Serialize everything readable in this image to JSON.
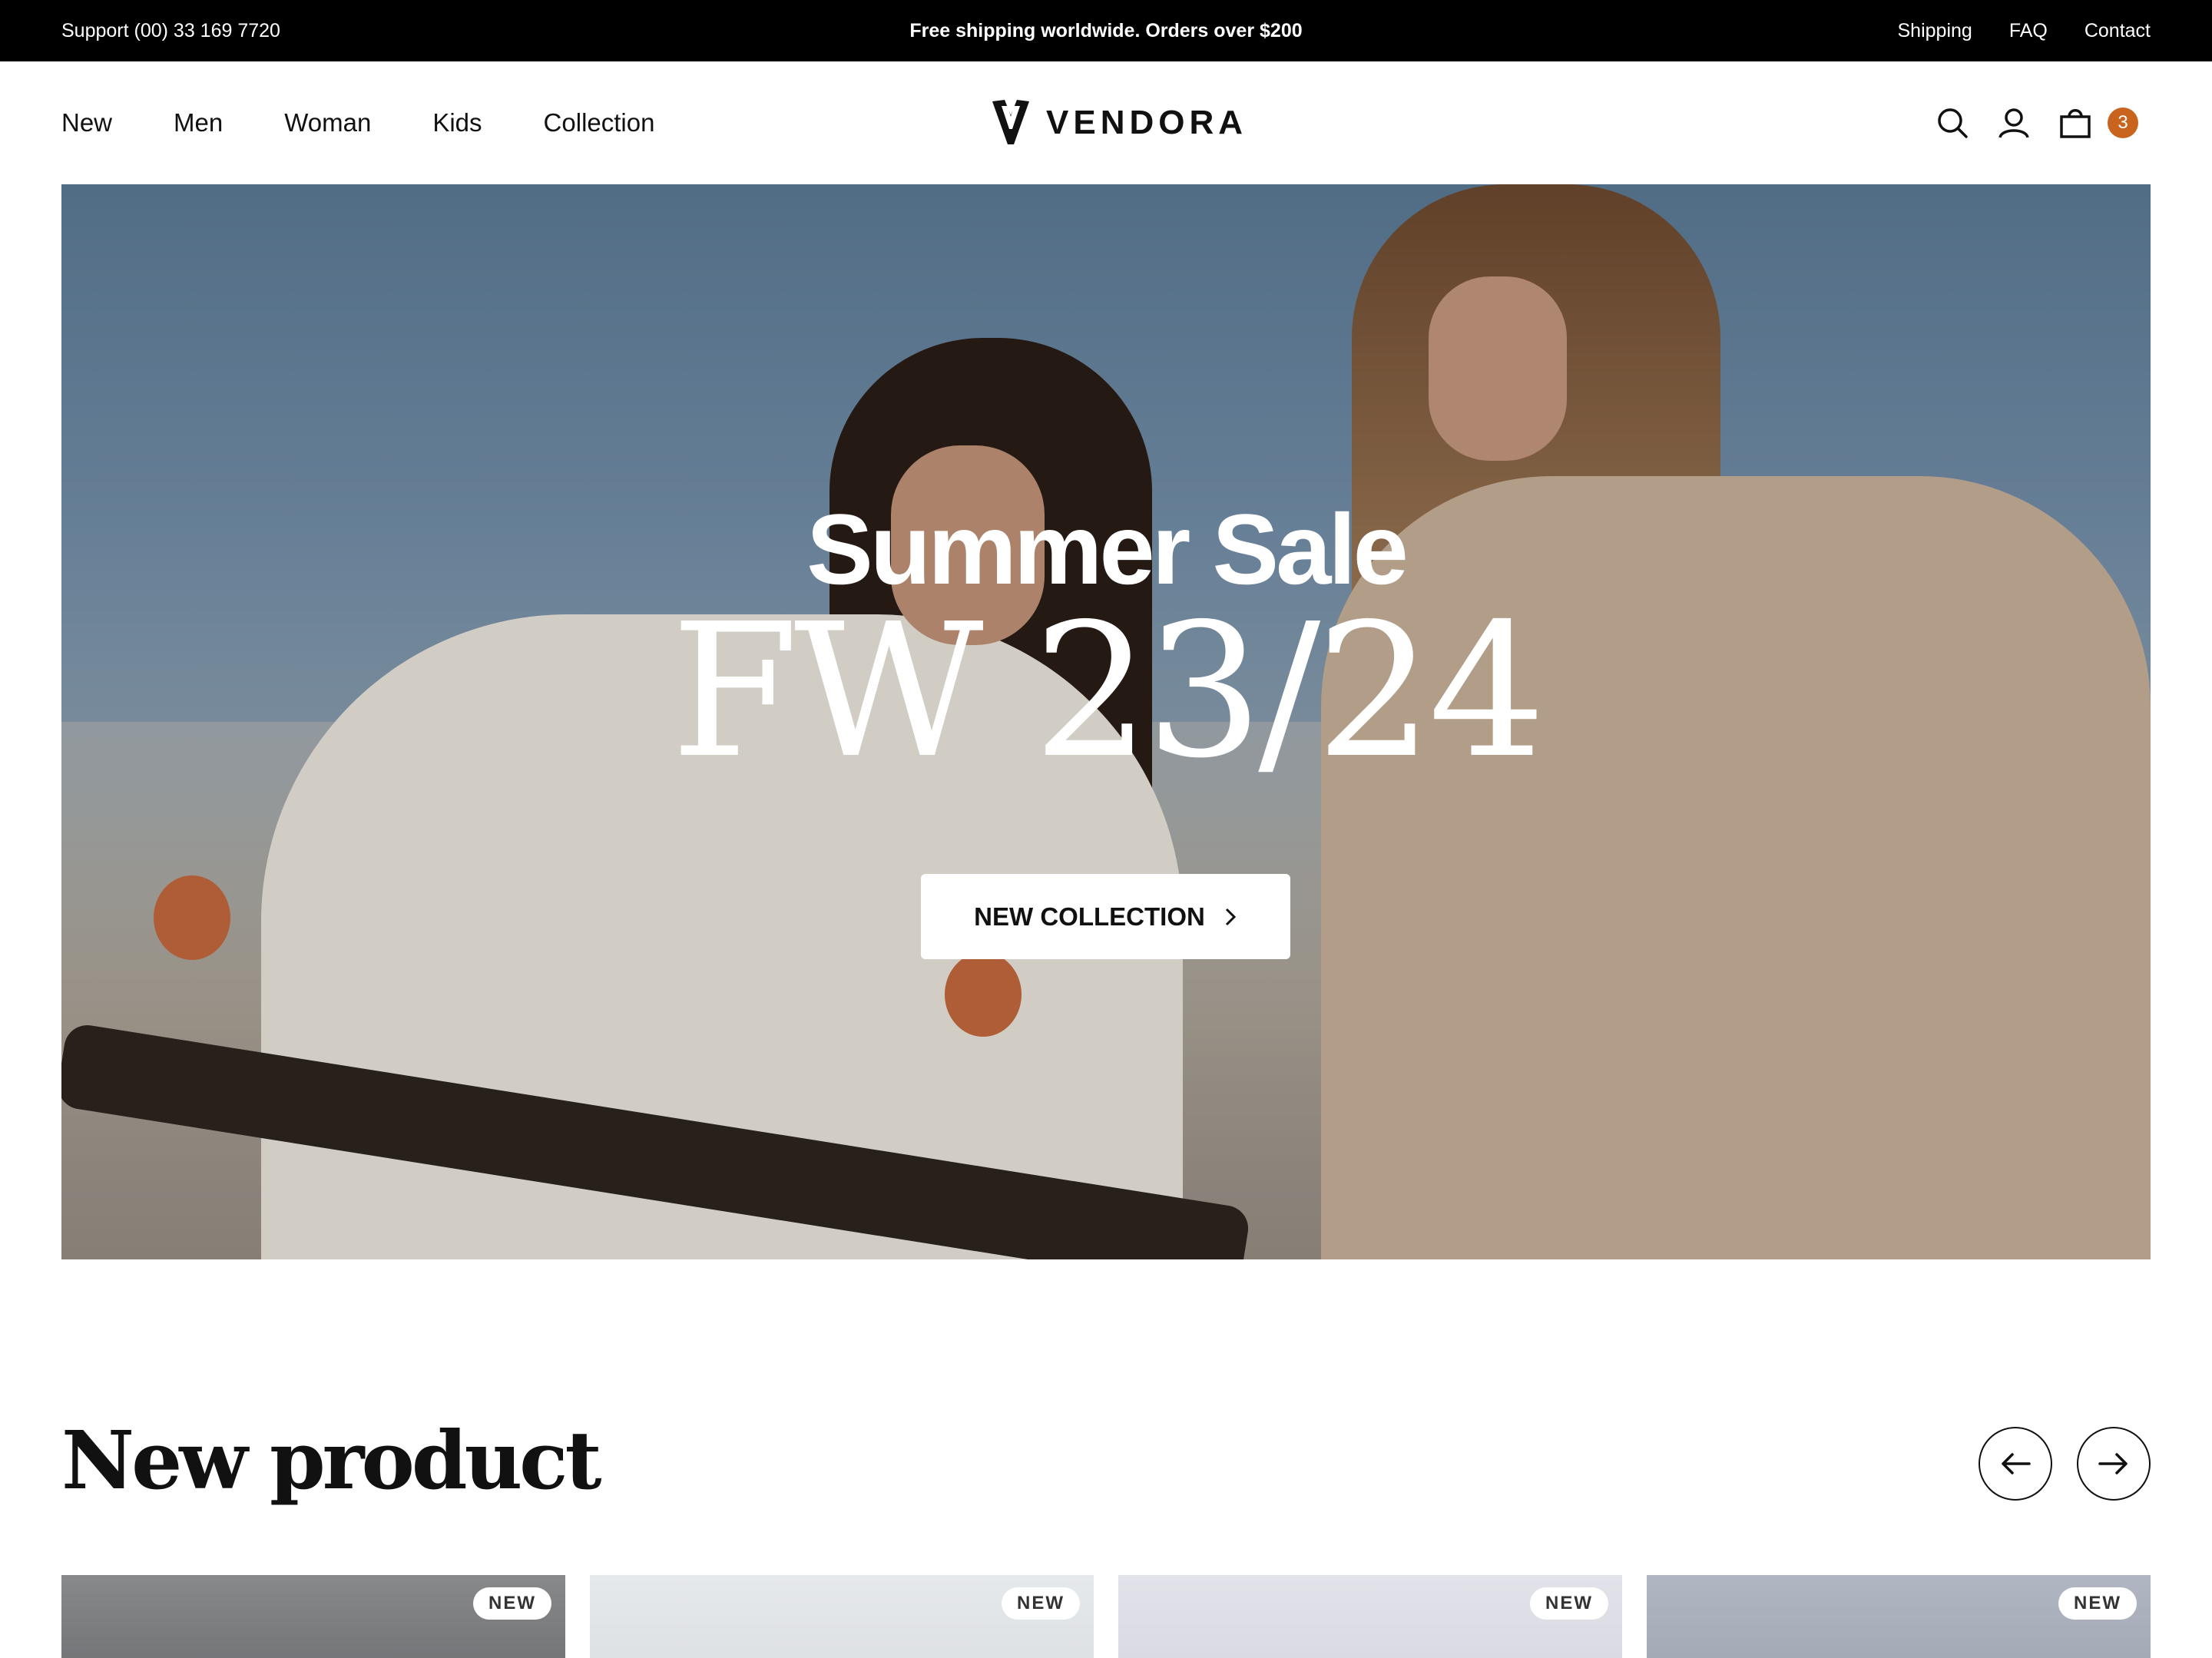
{
  "topbar": {
    "support": "Support (00) 33 169 7720",
    "promo": "Free shipping worldwide. Orders over $200",
    "links": [
      "Shipping",
      "FAQ",
      "Contact"
    ]
  },
  "header": {
    "nav": [
      "New",
      "Men",
      "Woman",
      "Kids",
      "Collection"
    ],
    "logo_text": "VENDORA",
    "icons": [
      "search-icon",
      "user-icon",
      "cart-icon"
    ],
    "cart_count": "3"
  },
  "hero": {
    "title": "Summer Sale",
    "subtitle": "FW 23/24",
    "button_label": "NEW COLLECTION",
    "button_icon": "chevron-right-icon"
  },
  "products": {
    "title": "New product",
    "prev_icon": "arrow-left-icon",
    "next_icon": "arrow-right-icon",
    "cards": [
      {
        "tag": "NEW",
        "tone": "#7d7f82"
      },
      {
        "tag": "NEW",
        "tone": "#e3e6e9"
      },
      {
        "tag": "NEW",
        "tone": "#dcdde5"
      },
      {
        "tag": "NEW",
        "tone": "#a9afbb"
      }
    ]
  },
  "colors": {
    "accent": "#c8641d",
    "topbar_bg": "#000000"
  }
}
